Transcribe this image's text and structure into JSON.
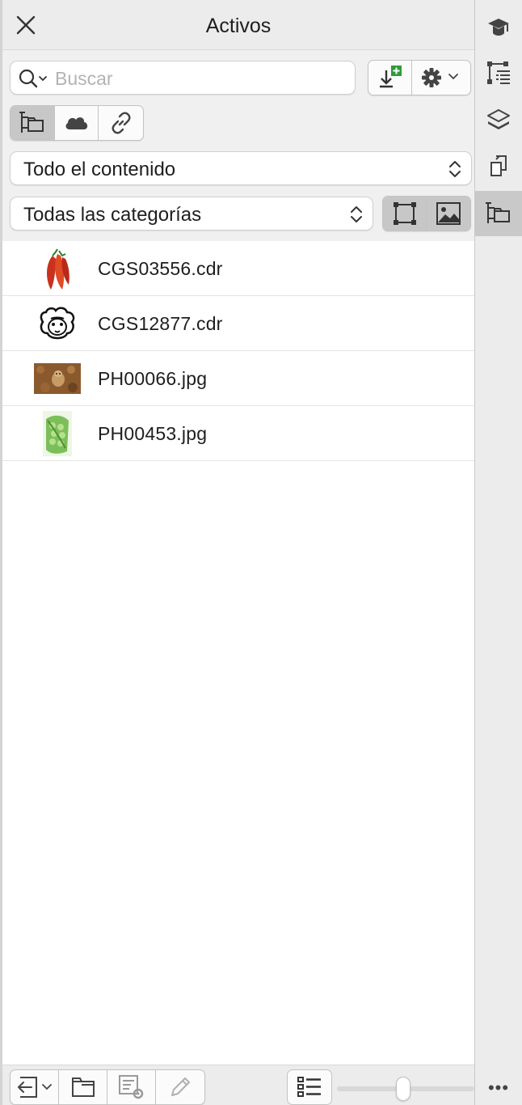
{
  "panel": {
    "title": "Activos",
    "search": {
      "placeholder": "Buscar",
      "value": ""
    },
    "content_filter": "Todo el contenido",
    "category_filter": "Todas las categorías",
    "assets": [
      {
        "name": "CGS03556.cdr",
        "icon": "chili-peppers-thumbnail"
      },
      {
        "name": "CGS12877.cdr",
        "icon": "sheep-thumbnail"
      },
      {
        "name": "PH00066.jpg",
        "icon": "dog-photo-thumbnail"
      },
      {
        "name": "PH00453.jpg",
        "icon": "peas-photo-thumbnail"
      }
    ],
    "thumbnail_size_fraction": 0.48
  },
  "colors": {
    "accent_green": "#2e9b3b",
    "selected": "#c9c9c9"
  }
}
